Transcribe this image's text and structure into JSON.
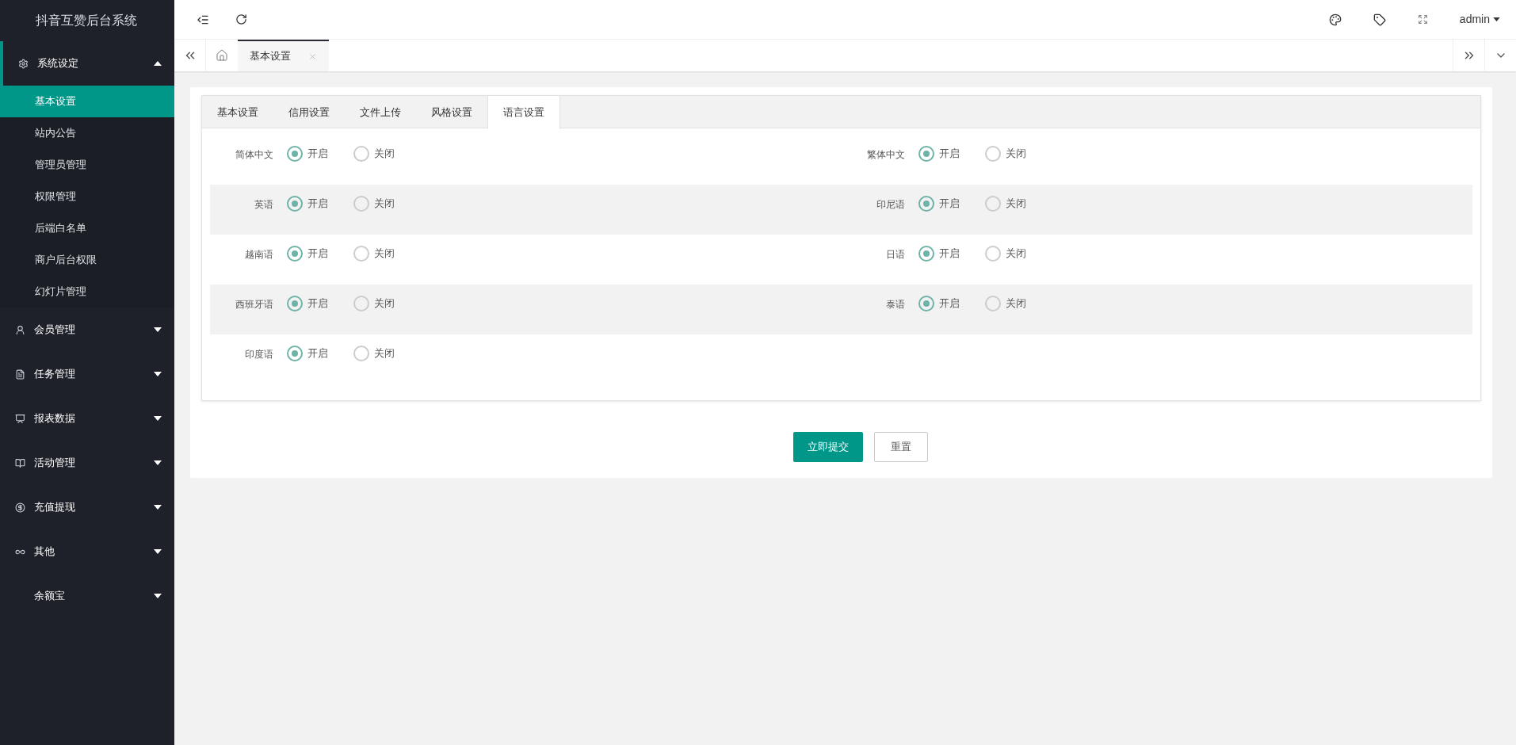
{
  "sidebar": {
    "title": "抖音互赞后台系统",
    "groups": [
      {
        "label": "系统设定",
        "expanded": true,
        "children": [
          {
            "label": "基本设置",
            "selected": true
          },
          {
            "label": "站内公告",
            "selected": false
          },
          {
            "label": "管理员管理",
            "selected": false
          },
          {
            "label": "权限管理",
            "selected": false
          },
          {
            "label": "后端白名单",
            "selected": false
          },
          {
            "label": "商户后台权限",
            "selected": false
          },
          {
            "label": "幻灯片管理",
            "selected": false
          }
        ]
      },
      {
        "label": "会员管理",
        "expanded": false
      },
      {
        "label": "任务管理",
        "expanded": false
      },
      {
        "label": "报表数据",
        "expanded": false
      },
      {
        "label": "活动管理",
        "expanded": false
      },
      {
        "label": "充值提现",
        "expanded": false
      },
      {
        "label": "其他",
        "expanded": false
      },
      {
        "label": "余额宝",
        "expanded": false
      }
    ]
  },
  "header": {
    "user": "admin"
  },
  "page_tabs": [
    {
      "label": "基本设置",
      "selected": true
    }
  ],
  "settings_tabs": [
    {
      "label": "基本设置",
      "selected": false
    },
    {
      "label": "信用设置",
      "selected": false
    },
    {
      "label": "文件上传",
      "selected": false
    },
    {
      "label": "风格设置",
      "selected": false
    },
    {
      "label": "语言设置",
      "selected": true
    }
  ],
  "languages": [
    {
      "label": "简体中文",
      "options": [
        {
          "label": "开启",
          "selected": true
        },
        {
          "label": "关闭",
          "selected": false
        }
      ]
    },
    {
      "label": "繁体中文",
      "options": [
        {
          "label": "开启",
          "selected": true
        },
        {
          "label": "关闭",
          "selected": false
        }
      ]
    },
    {
      "label": "英语",
      "options": [
        {
          "label": "开启",
          "selected": true
        },
        {
          "label": "关闭",
          "selected": false
        }
      ]
    },
    {
      "label": "印尼语",
      "options": [
        {
          "label": "开启",
          "selected": true
        },
        {
          "label": "关闭",
          "selected": false
        }
      ]
    },
    {
      "label": "越南语",
      "options": [
        {
          "label": "开启",
          "selected": true
        },
        {
          "label": "关闭",
          "selected": false
        }
      ]
    },
    {
      "label": "日语",
      "options": [
        {
          "label": "开启",
          "selected": true
        },
        {
          "label": "关闭",
          "selected": false
        }
      ]
    },
    {
      "label": "西班牙语",
      "options": [
        {
          "label": "开启",
          "selected": true
        },
        {
          "label": "关闭",
          "selected": false
        }
      ]
    },
    {
      "label": "泰语",
      "options": [
        {
          "label": "开启",
          "selected": true
        },
        {
          "label": "关闭",
          "selected": false
        }
      ]
    },
    {
      "label": "印度语",
      "options": [
        {
          "label": "开启",
          "selected": true
        },
        {
          "label": "关闭",
          "selected": false
        }
      ]
    }
  ],
  "buttons": {
    "submit": "立即提交",
    "reset": "重置"
  }
}
